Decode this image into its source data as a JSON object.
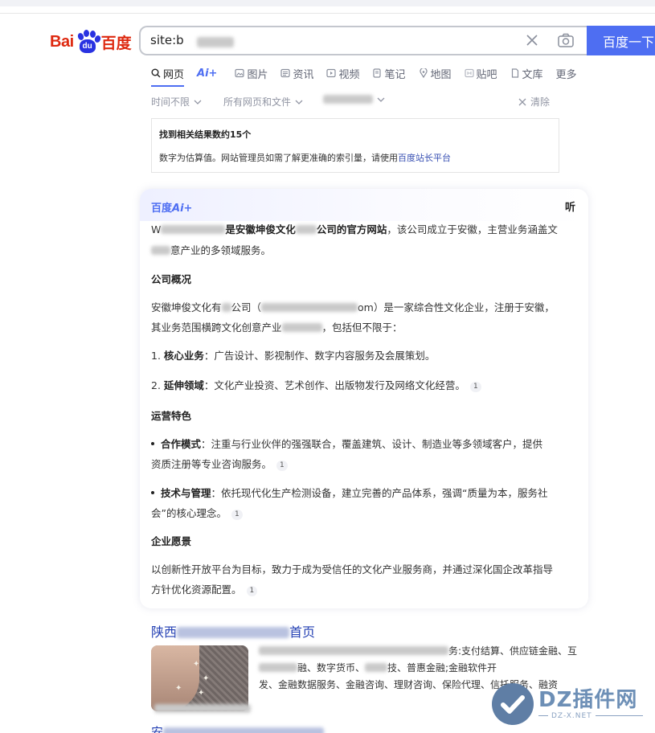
{
  "logo": {
    "bai": "Bai",
    "du_mark": "du",
    "baidu_cn": "百度"
  },
  "search": {
    "query_prefix": "site:b"
  },
  "search_button": {
    "label": "百度一下"
  },
  "tabs": [
    {
      "label": "网页",
      "icon": "search-icon",
      "active": true
    },
    {
      "label": "Ai+",
      "icon": "",
      "active": false
    },
    {
      "label": "图片",
      "icon": "image-icon",
      "active": false
    },
    {
      "label": "资讯",
      "icon": "news-icon",
      "active": false
    },
    {
      "label": "视频",
      "icon": "video-icon",
      "active": false
    },
    {
      "label": "笔记",
      "icon": "note-icon",
      "active": false
    },
    {
      "label": "地图",
      "icon": "map-icon",
      "active": false
    },
    {
      "label": "贴吧",
      "icon": "tieba-icon",
      "active": false
    },
    {
      "label": "文库",
      "icon": "document-icon",
      "active": false
    },
    {
      "label": "更多",
      "icon": "",
      "active": false
    }
  ],
  "filters": {
    "time": "时间不限",
    "scope": "所有网页和文件",
    "clear": "清除"
  },
  "count_box": {
    "title": "找到相关结果数约15个",
    "note": "数字为估算值。网站管理员如需了解更准确的索引量，请使用",
    "link": "百度站长平台"
  },
  "ai_card": {
    "logo_cn": "百度",
    "logo_ai": "Ai+",
    "listen": "听",
    "intro_a": "W",
    "intro_b": "是安徽坤俊文化",
    "intro_c": "公司的官方网站",
    "intro_d": "，该公司成立于安徽，主营业务涵盖文",
    "intro_e": "意产业的多领域服务。",
    "section1": "公司概况",
    "p1_a": "安徽坤俊文化有",
    "p1_b": "公司（",
    "p1_c": "om）是一家综合性文化企业，注册于安徽，",
    "p1_d": "其业务范围横跨文化创意产业",
    "p1_e": "，包括但不限于：",
    "item1_num": "1. ",
    "item1_bold": "核心业务",
    "item1_text": "：广告设计、影视制作、数字内容服务及会展策划。",
    "item2_num": "2. ",
    "item2_bold": "延伸领域",
    "item2_text": "：文化产业投资、艺术创作、出版物发行及网络文化经营。",
    "section2": "运营特色",
    "b1_bold": "合作模式",
    "b1_text": "：注重与行业伙伴的强强联合，覆盖建筑、设计、制造业等多领域客户，提供",
    "b1_text2": "资质注册等专业咨询服务。",
    "b2_bold": "技术与管理",
    "b2_text": "：依托现代化生产检测设备，建立完善的产品体系，强调“质量为本，服务社",
    "b2_text2": "会”的核心理念。",
    "section3": "企业愿景",
    "p3_a": "以创新性开放平台为目标，致力于成为受信任的文化产业服务商，并通过深化国企改革指导",
    "p3_b": "方针优化资源配置。",
    "cite": "1"
  },
  "result": {
    "title_a": "陕西",
    "title_b": "首页",
    "desc1": "务:支付结算、供应链金融、互",
    "desc2": "融、数字货币、",
    "desc2b": "技、普惠金融;金融软件开",
    "desc3": "发、金融数据服务、金融咨询、理财咨询、保险代理、信托服务、融资"
  },
  "watermark": {
    "text": "DZ插件网",
    "sub": "DZ-X.NET"
  },
  "bottom": {
    "title": "安"
  }
}
